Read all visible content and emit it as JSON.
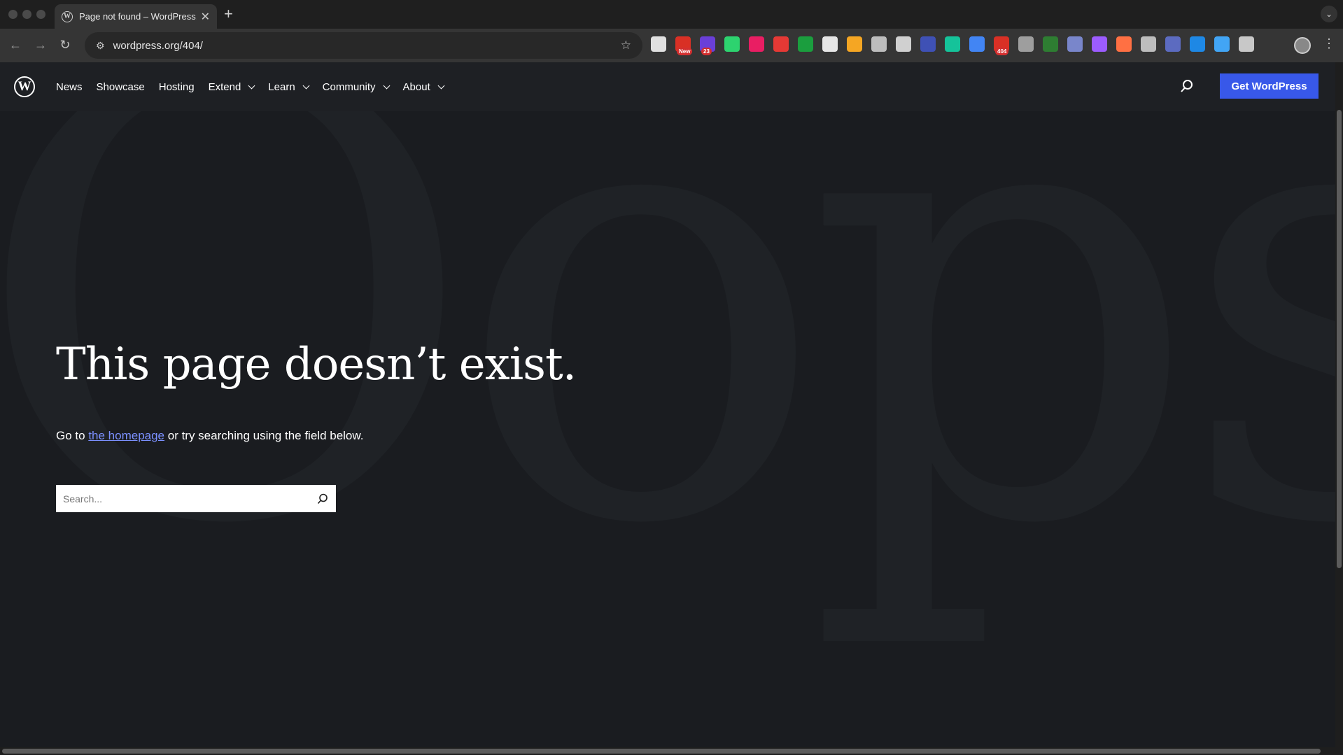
{
  "browser": {
    "tab": {
      "title": "Page not found – WordPress.org",
      "favicon": "wordpress-icon"
    },
    "url": "wordpress.org/404/",
    "extensions": [
      {
        "name": "eyedropper-icon",
        "color": "#e0e0e0"
      },
      {
        "name": "new-extension-icon",
        "color": "#d93025",
        "badge": "New"
      },
      {
        "name": "counter-extension-icon",
        "color": "#6a3fd8",
        "badge": "23"
      },
      {
        "name": "checkmark-extension-icon",
        "color": "#2dd36f"
      },
      {
        "name": "video-extension-icon",
        "color": "#e91e63"
      },
      {
        "name": "hand-extension-icon",
        "color": "#e53935"
      },
      {
        "name": "grammar-extension-icon",
        "color": "#1b9e3e"
      },
      {
        "name": "box-extension-icon",
        "color": "#e6e6e6"
      },
      {
        "name": "pencil-extension-icon",
        "color": "#f5a623"
      },
      {
        "name": "camera-extension-icon",
        "color": "#bdbdbd"
      },
      {
        "name": "globe-extension-icon",
        "color": "#d0d0d0"
      },
      {
        "name": "z-extension-icon",
        "color": "#3f51b5"
      },
      {
        "name": "grammarly-icon",
        "color": "#15c39a"
      },
      {
        "name": "translate-extension-icon",
        "color": "#4285f4"
      },
      {
        "name": "error-extension-icon",
        "color": "#d93025",
        "badge": "404"
      },
      {
        "name": "target-extension-icon",
        "color": "#9e9e9e"
      },
      {
        "name": "download-extension-icon",
        "color": "#2e7d32"
      },
      {
        "name": "dots-extension-icon",
        "color": "#7986cb"
      },
      {
        "name": "feather-extension-icon",
        "color": "#9c5cff"
      },
      {
        "name": "grid-extension-icon",
        "color": "#ff7043"
      },
      {
        "name": "circle-extension-icon",
        "color": "#bdbdbd"
      },
      {
        "name": "gear-extension-icon",
        "color": "#5c6bc0"
      },
      {
        "name": "f-extension-icon",
        "color": "#1e88e5"
      },
      {
        "name": "window-extension-icon",
        "color": "#42a5f5"
      },
      {
        "name": "puzzle-icon",
        "color": "#c8c8c8"
      }
    ]
  },
  "header": {
    "nav": [
      {
        "id": "news",
        "label": "News",
        "dropdown": false
      },
      {
        "id": "showcase",
        "label": "Showcase",
        "dropdown": false
      },
      {
        "id": "hosting",
        "label": "Hosting",
        "dropdown": false
      },
      {
        "id": "extend",
        "label": "Extend",
        "dropdown": true
      },
      {
        "id": "learn",
        "label": "Learn",
        "dropdown": true
      },
      {
        "id": "community",
        "label": "Community",
        "dropdown": true
      },
      {
        "id": "about",
        "label": "About",
        "dropdown": true
      }
    ],
    "cta_label": "Get WordPress"
  },
  "main": {
    "background_word": "Oops!",
    "heading": "This page doesn’t exist.",
    "text_before_link": "Go to ",
    "link_label": "the homepage",
    "text_after_link": " or try searching using the field below.",
    "search_placeholder": "Search..."
  },
  "colors": {
    "page_bg": "#1a1c20",
    "header_bg": "#1e2024",
    "accent": "#3858e9",
    "link": "#7b90ff"
  }
}
